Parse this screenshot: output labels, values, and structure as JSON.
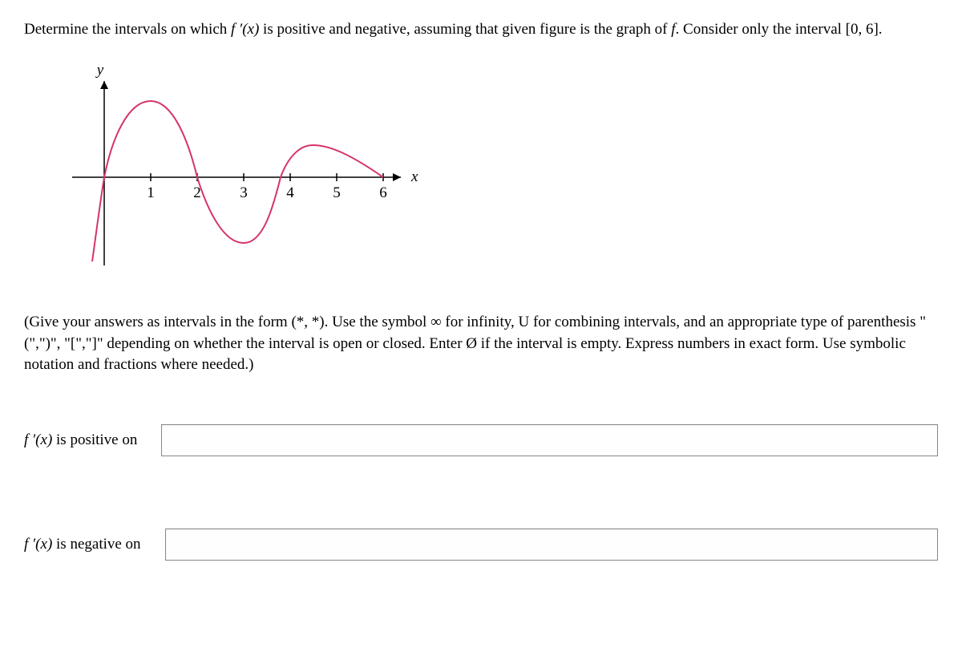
{
  "question": {
    "prefix": "Determine the intervals on which ",
    "fprime": "f ′(x)",
    "mid1": " is positive and negative, assuming that given figure is the graph of ",
    "f": "f",
    "suffix": ". Consider only the interval [0, 6]."
  },
  "instructions": {
    "text1": "(Give your answers as intervals in the form (*, *). Use the symbol ∞ for infinity, U for combining intervals, and an appropriate type of parenthesis \"(\",\")\", \"[\",\"]\" depending on whether the interval is open or closed. Enter Ø if the interval is empty. Express numbers in exact form. Use symbolic notation and fractions where needed.)"
  },
  "answers": {
    "positive_label_prefix": "f ′(x)",
    "positive_label_suffix": " is positive on",
    "negative_label_prefix": "f ′(x)",
    "negative_label_suffix": " is negative on",
    "positive_value": "",
    "negative_value": ""
  },
  "chart_data": {
    "type": "line",
    "title": "",
    "xlabel": "x",
    "ylabel": "y",
    "x_ticks": [
      1,
      2,
      3,
      4,
      5,
      6
    ],
    "xlim": [
      -0.5,
      6.5
    ],
    "description": "Curve of f: starts below x-axis before x=0, rises steeply through origin, local max near x=1, descends through x=2, local min near x=3, rises through x≈3.8, smaller local max near x=4.5, descends gently to x-axis at x=6.",
    "critical_points_x": [
      1,
      3,
      4.5
    ],
    "x_intercepts_approx": [
      0,
      2,
      3.8,
      6
    ]
  }
}
